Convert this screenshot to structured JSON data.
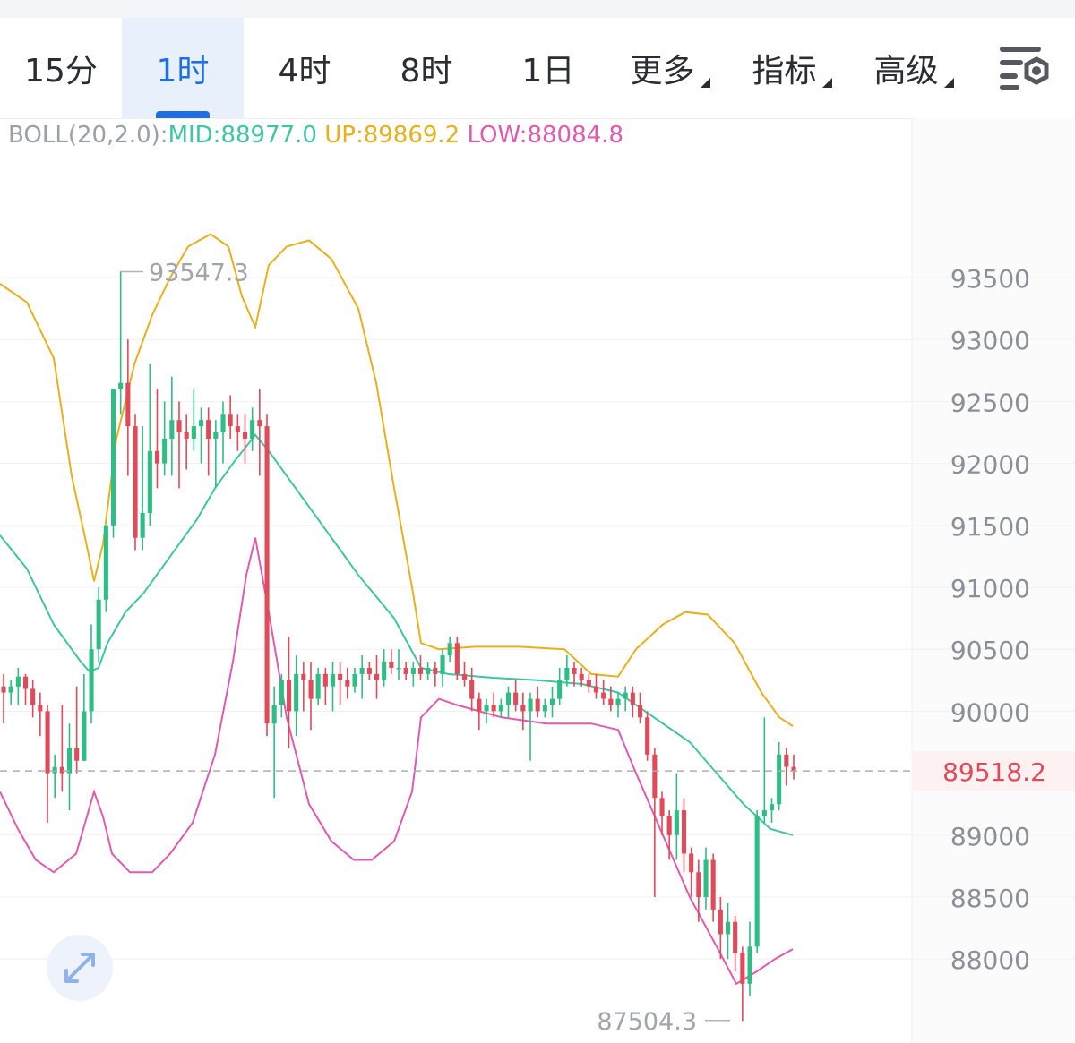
{
  "tabs": [
    {
      "label": "15分",
      "active": false,
      "has_menu": false
    },
    {
      "label": "1时",
      "active": true,
      "has_menu": false
    },
    {
      "label": "4时",
      "active": false,
      "has_menu": false
    },
    {
      "label": "8时",
      "active": false,
      "has_menu": false
    },
    {
      "label": "1日",
      "active": false,
      "has_menu": false
    },
    {
      "label": "更多",
      "active": false,
      "has_menu": true
    },
    {
      "label": "指标",
      "active": false,
      "has_menu": true
    },
    {
      "label": "高级",
      "active": false,
      "has_menu": true
    }
  ],
  "settings_icon": "chart-settings-icon",
  "expand_icon": "expand-arrows-icon",
  "indicator": {
    "name": "BOLL(20,2.0):",
    "mid": "MID:88977.0",
    "up": "UP:89869.2",
    "low": "LOW:88084.8"
  },
  "colors": {
    "up_candle": "#2ebd85",
    "down_candle": "#e04a59",
    "mid": "#3fc4a4",
    "upper": "#e8b01c",
    "lower": "#e05ab0",
    "current_price": "#e04a59",
    "active_tab": "#1f6fe0"
  },
  "chart_data": {
    "type": "candlestick",
    "y_ticks": [
      93500,
      93000,
      92500,
      92000,
      91500,
      91000,
      90500,
      90000,
      89000,
      88500,
      88000
    ],
    "y_range": [
      87450,
      94700
    ],
    "current_price": 89518.2,
    "current_price_label": "89518.2",
    "high_label": "93547.3",
    "low_label": "87504.3",
    "candles": [
      [
        90200,
        90300,
        89900,
        90150
      ],
      [
        90150,
        90250,
        90050,
        90200
      ],
      [
        90200,
        90350,
        90050,
        90280
      ],
      [
        90280,
        90300,
        90050,
        90180
      ],
      [
        90180,
        90250,
        89950,
        90050
      ],
      [
        90050,
        90150,
        89800,
        90000
      ],
      [
        90000,
        90050,
        89100,
        89500
      ],
      [
        89500,
        89650,
        89300,
        89550
      ],
      [
        89550,
        90050,
        89350,
        89500
      ],
      [
        89500,
        89900,
        89200,
        89700
      ],
      [
        89700,
        90200,
        89500,
        89600
      ],
      [
        89600,
        90300,
        89600,
        90000
      ],
      [
        90000,
        90700,
        89900,
        90500
      ],
      [
        90500,
        91000,
        90400,
        90900
      ],
      [
        90900,
        91500,
        90800,
        91500
      ],
      [
        91500,
        92600,
        91400,
        92600
      ],
      [
        92600,
        93550,
        92400,
        92650
      ],
      [
        92650,
        93000,
        91900,
        92300
      ],
      [
        92300,
        92400,
        91300,
        91400
      ],
      [
        91400,
        92300,
        91300,
        91600
      ],
      [
        91600,
        92800,
        91500,
        92100
      ],
      [
        92100,
        92600,
        91800,
        92000
      ],
      [
        92000,
        92500,
        91900,
        92200
      ],
      [
        92200,
        92700,
        91900,
        92350
      ],
      [
        92350,
        92500,
        91800,
        92250
      ],
      [
        92250,
        92400,
        91950,
        92200
      ],
      [
        92200,
        92600,
        92100,
        92300
      ],
      [
        92300,
        92450,
        92000,
        92350
      ],
      [
        92350,
        92450,
        91900,
        92200
      ],
      [
        92200,
        92350,
        91800,
        92250
      ],
      [
        92250,
        92500,
        92000,
        92400
      ],
      [
        92400,
        92550,
        92200,
        92300
      ],
      [
        92300,
        92400,
        92100,
        92250
      ],
      [
        92250,
        92400,
        92000,
        92200
      ],
      [
        92200,
        92450,
        92100,
        92350
      ],
      [
        92350,
        92600,
        91900,
        92300
      ],
      [
        92300,
        92400,
        89800,
        89900
      ],
      [
        89900,
        90200,
        89300,
        90050
      ],
      [
        90050,
        90300,
        89950,
        90250
      ],
      [
        90250,
        90600,
        89700,
        90000
      ],
      [
        90000,
        90450,
        89800,
        90300
      ],
      [
        90300,
        90400,
        90000,
        90250
      ],
      [
        90250,
        90400,
        89850,
        90100
      ],
      [
        90100,
        90350,
        90050,
        90300
      ],
      [
        90300,
        90350,
        90050,
        90200
      ],
      [
        90200,
        90400,
        90000,
        90300
      ],
      [
        90300,
        90400,
        90050,
        90250
      ],
      [
        90250,
        90350,
        90100,
        90200
      ],
      [
        90200,
        90350,
        90150,
        90300
      ],
      [
        90300,
        90450,
        90100,
        90350
      ],
      [
        90350,
        90400,
        90250,
        90300
      ],
      [
        90300,
        90450,
        90100,
        90250
      ],
      [
        90250,
        90500,
        90200,
        90400
      ],
      [
        90400,
        90500,
        90300,
        90350
      ],
      [
        90350,
        90500,
        90250,
        90350
      ],
      [
        90350,
        90400,
        90250,
        90300
      ],
      [
        90300,
        90400,
        90200,
        90350
      ],
      [
        90350,
        90450,
        90250,
        90300
      ],
      [
        90300,
        90400,
        90250,
        90350
      ],
      [
        90350,
        90400,
        90200,
        90300
      ],
      [
        90300,
        90500,
        90200,
        90450
      ],
      [
        90450,
        90600,
        90400,
        90550
      ],
      [
        90550,
        90600,
        90250,
        90300
      ],
      [
        90300,
        90400,
        90200,
        90250
      ],
      [
        90250,
        90350,
        90000,
        90100
      ],
      [
        90100,
        90150,
        89850,
        90000
      ],
      [
        90000,
        90100,
        89900,
        90050
      ],
      [
        90050,
        90150,
        89950,
        90000
      ],
      [
        90000,
        90100,
        89950,
        90050
      ],
      [
        90050,
        90200,
        89950,
        90150
      ],
      [
        90150,
        90250,
        90000,
        90050
      ],
      [
        90050,
        90150,
        89850,
        90000
      ],
      [
        90000,
        90150,
        89600,
        90100
      ],
      [
        90100,
        90200,
        89950,
        90000
      ],
      [
        90000,
        90100,
        89950,
        90050
      ],
      [
        90050,
        90200,
        89950,
        90100
      ],
      [
        90100,
        90350,
        90050,
        90250
      ],
      [
        90250,
        90450,
        90200,
        90350
      ],
      [
        90350,
        90400,
        90200,
        90300
      ],
      [
        90300,
        90350,
        90200,
        90250
      ],
      [
        90250,
        90300,
        90150,
        90200
      ],
      [
        90200,
        90300,
        90100,
        90150
      ],
      [
        90150,
        90250,
        90050,
        90100
      ],
      [
        90100,
        90200,
        90000,
        90050
      ],
      [
        90050,
        90150,
        89950,
        90100
      ],
      [
        90100,
        90200,
        90000,
        90150
      ],
      [
        90150,
        90200,
        89950,
        90050
      ],
      [
        90050,
        90150,
        89900,
        89950
      ],
      [
        89950,
        90000,
        89600,
        89650
      ],
      [
        89650,
        89700,
        88500,
        89300
      ],
      [
        89300,
        89350,
        89000,
        89150
      ],
      [
        89150,
        89200,
        88800,
        89000
      ],
      [
        89000,
        89500,
        88800,
        89200
      ],
      [
        89200,
        89300,
        88700,
        88850
      ],
      [
        88850,
        88900,
        88500,
        88700
      ],
      [
        88700,
        88800,
        88300,
        88500
      ],
      [
        88500,
        88900,
        88400,
        88800
      ],
      [
        88800,
        88850,
        88300,
        88400
      ],
      [
        88400,
        88500,
        88000,
        88200
      ],
      [
        88200,
        88450,
        88000,
        88300
      ],
      [
        88300,
        88350,
        87900,
        88050
      ],
      [
        88050,
        88100,
        87500,
        87800
      ],
      [
        87800,
        88300,
        87700,
        88100
      ],
      [
        88100,
        89200,
        88050,
        89150
      ],
      [
        89150,
        89950,
        89100,
        89200
      ],
      [
        89200,
        89300,
        89100,
        89250
      ],
      [
        89250,
        89750,
        89200,
        89650
      ],
      [
        89650,
        89700,
        89400,
        89550
      ],
      [
        89550,
        89650,
        89450,
        89518.2
      ]
    ],
    "mid_line": [
      [
        0,
        91420
      ],
      [
        30,
        91150
      ],
      [
        60,
        90700
      ],
      [
        90,
        90400
      ],
      [
        100,
        90320
      ],
      [
        110,
        90350
      ],
      [
        120,
        90550
      ],
      [
        140,
        90800
      ],
      [
        160,
        90950
      ],
      [
        180,
        91150
      ],
      [
        200,
        91350
      ],
      [
        220,
        91550
      ],
      [
        240,
        91800
      ],
      [
        260,
        92000
      ],
      [
        285,
        92230
      ],
      [
        300,
        92100
      ],
      [
        330,
        91800
      ],
      [
        360,
        91500
      ],
      [
        400,
        91100
      ],
      [
        440,
        90750
      ],
      [
        470,
        90350
      ],
      [
        500,
        90300
      ],
      [
        550,
        90270
      ],
      [
        600,
        90250
      ],
      [
        650,
        90220
      ],
      [
        690,
        90150
      ],
      [
        730,
        89950
      ],
      [
        770,
        89750
      ],
      [
        800,
        89500
      ],
      [
        830,
        89250
      ],
      [
        860,
        89050
      ],
      [
        885,
        89000
      ]
    ],
    "upper_line": [
      [
        0,
        93450
      ],
      [
        30,
        93300
      ],
      [
        60,
        92850
      ],
      [
        80,
        91900
      ],
      [
        95,
        91400
      ],
      [
        105,
        91050
      ],
      [
        115,
        91350
      ],
      [
        130,
        92200
      ],
      [
        150,
        92800
      ],
      [
        170,
        93200
      ],
      [
        190,
        93500
      ],
      [
        210,
        93750
      ],
      [
        235,
        93850
      ],
      [
        255,
        93750
      ],
      [
        270,
        93350
      ],
      [
        285,
        93100
      ],
      [
        300,
        93600
      ],
      [
        320,
        93750
      ],
      [
        345,
        93800
      ],
      [
        370,
        93650
      ],
      [
        400,
        93250
      ],
      [
        420,
        92650
      ],
      [
        440,
        91800
      ],
      [
        460,
        91000
      ],
      [
        470,
        90550
      ],
      [
        490,
        90500
      ],
      [
        530,
        90520
      ],
      [
        580,
        90520
      ],
      [
        630,
        90500
      ],
      [
        660,
        90300
      ],
      [
        690,
        90280
      ],
      [
        710,
        90500
      ],
      [
        740,
        90700
      ],
      [
        765,
        90800
      ],
      [
        790,
        90780
      ],
      [
        820,
        90550
      ],
      [
        850,
        90150
      ],
      [
        870,
        89950
      ],
      [
        885,
        89880
      ]
    ],
    "lower_line": [
      [
        0,
        89350
      ],
      [
        20,
        89050
      ],
      [
        40,
        88800
      ],
      [
        60,
        88700
      ],
      [
        85,
        88850
      ],
      [
        95,
        89100
      ],
      [
        105,
        89350
      ],
      [
        115,
        89150
      ],
      [
        125,
        88850
      ],
      [
        145,
        88700
      ],
      [
        170,
        88700
      ],
      [
        190,
        88850
      ],
      [
        215,
        89100
      ],
      [
        240,
        89650
      ],
      [
        260,
        90400
      ],
      [
        275,
        91100
      ],
      [
        285,
        91400
      ],
      [
        300,
        90800
      ],
      [
        320,
        89950
      ],
      [
        345,
        89250
      ],
      [
        370,
        88950
      ],
      [
        395,
        88800
      ],
      [
        415,
        88800
      ],
      [
        440,
        88950
      ],
      [
        460,
        89350
      ],
      [
        470,
        89950
      ],
      [
        490,
        90100
      ],
      [
        510,
        90050
      ],
      [
        560,
        89950
      ],
      [
        610,
        89900
      ],
      [
        660,
        89900
      ],
      [
        690,
        89850
      ],
      [
        710,
        89500
      ],
      [
        740,
        89000
      ],
      [
        770,
        88500
      ],
      [
        800,
        88100
      ],
      [
        822,
        87800
      ],
      [
        845,
        87900
      ],
      [
        865,
        88000
      ],
      [
        885,
        88080
      ]
    ]
  }
}
